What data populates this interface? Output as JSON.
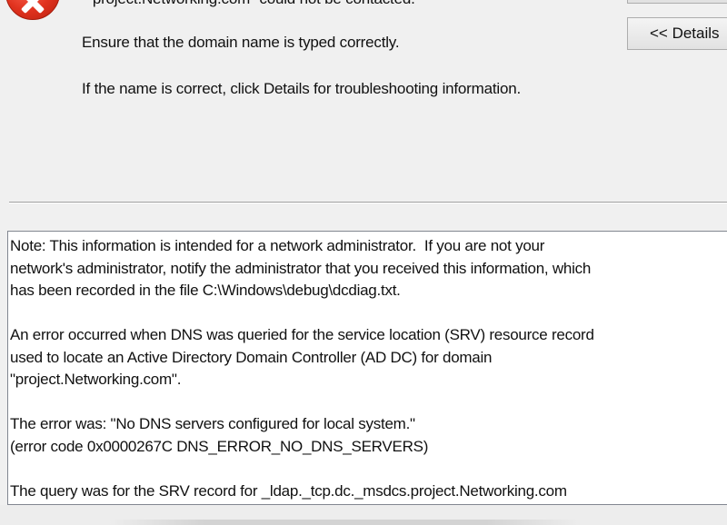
{
  "dialog": {
    "title_message": "\"project.Networking.com\" could not be contacted.",
    "line1": "Ensure that the domain name is typed correctly.",
    "line2": "If the name is correct, click Details for troubleshooting information.",
    "details_button_label": "<< Details",
    "icon": "error-x-icon",
    "details_text": "Note: This information is intended for a network administrator.  If you are not your\nnetwork's administrator, notify the administrator that you received this information, which\nhas been recorded in the file C:\\Windows\\debug\\dcdiag.txt.\n\nAn error occurred when DNS was queried for the service location (SRV) resource record\nused to locate an Active Directory Domain Controller (AD DC) for domain\n\"project.Networking.com\".\n\nThe error was: \"No DNS servers configured for local system.\"\n(error code 0x0000267C DNS_ERROR_NO_DNS_SERVERS)\n\nThe query was for the SRV record for _ldap._tcp.dc._msdcs.project.Networking.com"
  },
  "colors": {
    "background": "#f0f0f0",
    "error_red": "#e0321e",
    "text_box_bg": "#ffffff",
    "border": "#828790"
  }
}
